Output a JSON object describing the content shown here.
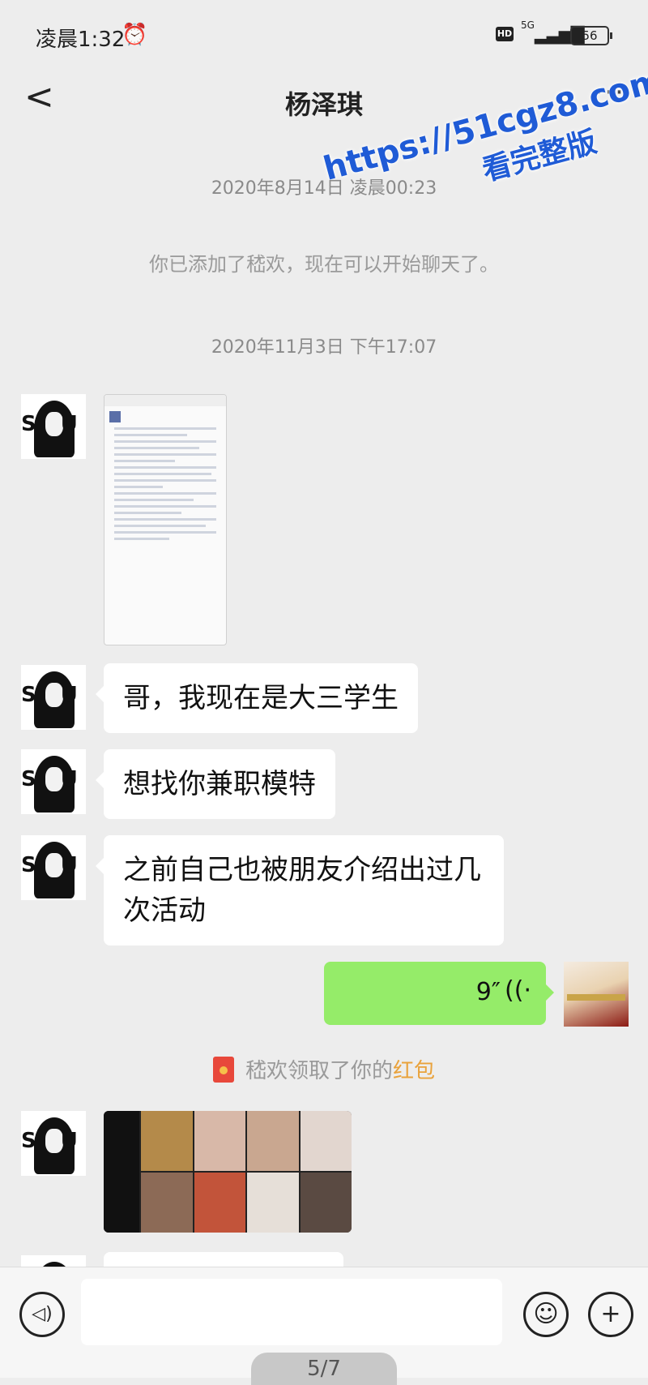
{
  "status_bar": {
    "time": "凌晨1:32",
    "network": "5G",
    "battery": "56",
    "hd": "HD"
  },
  "nav": {
    "back_label": "<",
    "title": "杨泽琪",
    "more_label": "···"
  },
  "watermark": {
    "url": "https://51cgz8.com",
    "text": "看完整版"
  },
  "messages": {
    "time1": "2020年8月14日 凌晨00:23",
    "system_added": "你已添加了嵇欢，现在可以开始聊天了。",
    "time2": "2020年11月3日 下午17:07",
    "msg1": "哥，我现在是大三学生",
    "msg2": "想找你兼职模特",
    "msg3": "之前自己也被朋友介绍出过几次活动",
    "voice_duration": "9″",
    "red_packet_prefix": "嵇欢领取了你的",
    "red_packet_word": "红包"
  },
  "input_bar": {
    "voice_icon": "voice-icon",
    "emoji_icon": "emoji-icon",
    "plus_icon": "plus-icon"
  },
  "pager": "5/7"
}
